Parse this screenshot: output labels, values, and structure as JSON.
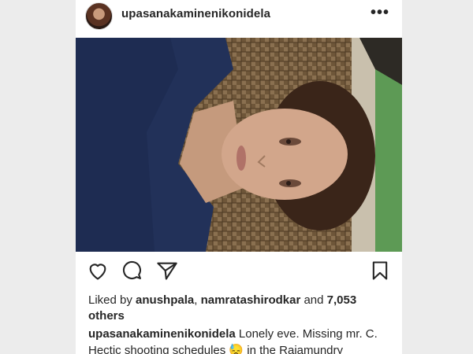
{
  "post": {
    "username": "upasanakaminenikonidela",
    "more_icon": "more-horizontal-icon",
    "image_alt": "selfie lying on wicker chair"
  },
  "actions": {
    "like_icon": "heart-icon",
    "comment_icon": "comment-icon",
    "share_icon": "send-icon",
    "save_icon": "bookmark-icon"
  },
  "likes": {
    "prefix": "Liked by ",
    "user1": "anushpala",
    "sep": ", ",
    "user2": "namratashirodkar",
    "and": " and ",
    "others": "7,053 others"
  },
  "caption": {
    "username": "upasanakaminenikonidela",
    "text": " Lonely eve. Missing mr. C. Hectic shooting schedules 😓 in the Rajamundry"
  },
  "colors": {
    "text": "#262626",
    "background": "#ffffff",
    "page": "#ececec"
  }
}
